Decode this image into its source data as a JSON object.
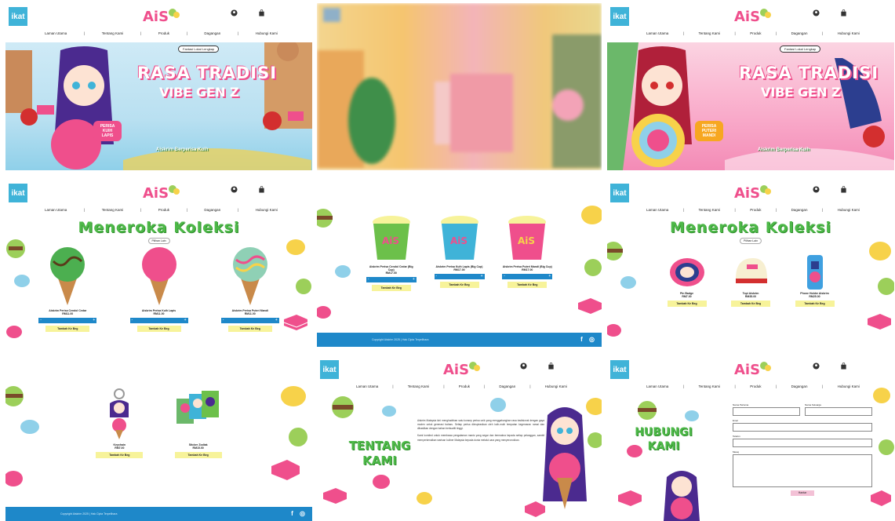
{
  "site": {
    "logo_text": "ikat",
    "brand": "Ais Kush",
    "nav": [
      "Laman Utama",
      "Tentang Kami",
      "Produk",
      "Dagangan",
      "Hubungi Kami"
    ],
    "icons": [
      "user-icon",
      "shopping-bag-icon"
    ]
  },
  "hero_blue": {
    "tag": "Fantasi Lokal Lengkap",
    "title": "RASA TRADISI",
    "subtitle": "VIBE GEN Z",
    "flavor": "PERISA KUIH LAPIS",
    "tagline": "Aiskrim Berperisa Kuih"
  },
  "hero_pink": {
    "tag": "Fantasi Lokal Lengkap",
    "title": "RASA TRADISI",
    "subtitle": "VIBE GEN Z",
    "flavor": "PERISA PUTERI MANDI",
    "tagline": "Aiskrim Berperisa Kuih"
  },
  "collection": {
    "title": "Meneroka Koleksi",
    "pill": "Pilihan Lain",
    "cones": [
      {
        "name": "Aiskrim Perisa Cendol Cedar",
        "price": "RM11.00",
        "color": "#4caf50"
      },
      {
        "name": "Aiskrim Perisa Kuih Lapis",
        "price": "RM11.00",
        "color": "#ef4f8c"
      },
      {
        "name": "Aiskrim Perisa Puteri Mandi",
        "price": "RM11.00",
        "color": "#8fd0b5"
      }
    ],
    "cups": [
      {
        "name": "Aiskrim Perisa Cendol Cedar (Big Cup)",
        "price": "RM17.00",
        "color": "#6cc04a"
      },
      {
        "name": "Aiskrim Perisa Kuih Lapis (Big Cup)",
        "price": "RM17.00",
        "color": "#3fb3d8"
      },
      {
        "name": "Aiskrim Perisa Puteri Mandi (Big Cup)",
        "price": "RM17.00",
        "color": "#ef4f8c"
      }
    ],
    "merch": [
      {
        "name": "Pin Badge",
        "price": "RM7.00"
      },
      {
        "name": "Topi Aiskrim",
        "price": "RM35.00"
      },
      {
        "name": "Phone Holder Aiskrim",
        "price": "RM25.00"
      }
    ],
    "merch2": [
      {
        "name": "Keychain",
        "price": "RM7.00"
      },
      {
        "name": "Sticker Zodiak",
        "price": "RM15.00"
      }
    ],
    "qty_minus": "-",
    "qty_plus": "+",
    "add_label": "Tambah Ke Beg"
  },
  "footer": {
    "text": "Copyright Aiskrim 2025 | Hak Cipta Terpelihara",
    "social": [
      "f",
      "◎"
    ]
  },
  "about": {
    "title": "TENTANG KAMI",
    "paragraphs": [
      "Aiskrim Malaysia kini menghadirkan satu konsep perisa unik yang menggabungkan rasa tradisional dengan gaya moden untuk generasi baharu. Setiap perisa diinspirasikan oleh kuih-muih tempatan kegemaran ramai dan dihasilkan dengan bahan berkualiti tinggi.",
      "Kami komited untuk membawa pengalaman manis yang segar dan bermakna kepada setiap pelanggan, sambil memperkenalkan warisan kuliner Malaysia kepada dunia melalui cara yang menyeronokkan."
    ]
  },
  "contact": {
    "title": "HUBUNGI KAMI",
    "fields": [
      "Nama Pertama",
      "Nama Keluarga",
      "Emel",
      "Telefon",
      "Mesej"
    ],
    "submit": "Hantar"
  }
}
